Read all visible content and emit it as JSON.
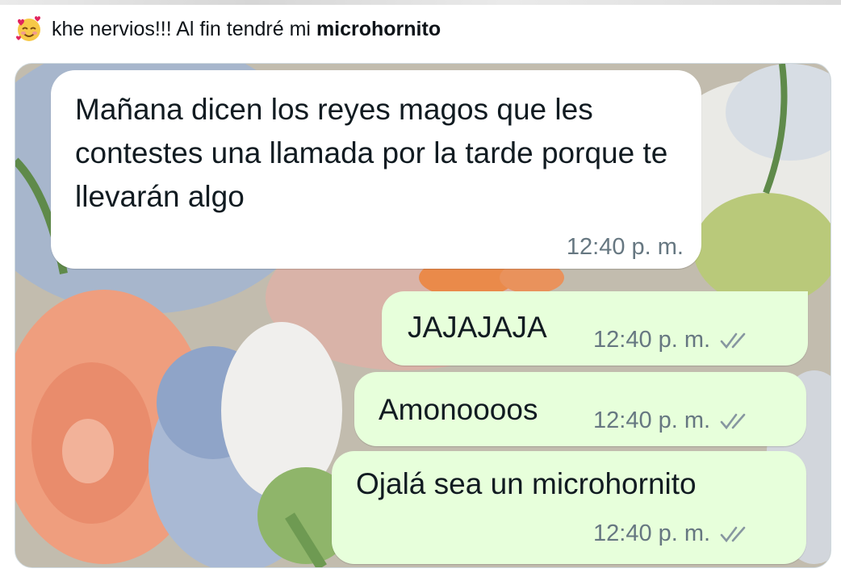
{
  "tweet": {
    "text": "khe nervios!!! Al fin tendré mi ",
    "bold": "microhornito",
    "emoji": "smiling-face-with-hearts-icon"
  },
  "chat": {
    "messages": [
      {
        "direction": "incoming",
        "text": "Mañana dicen los reyes magos que les contestes una llamada por la tarde porque te llevarán algo",
        "time": "12:40 p. m."
      },
      {
        "direction": "outgoing",
        "text": "JAJAJAJA",
        "time": "12:40 p. m.",
        "status": "read-ticks-icon"
      },
      {
        "direction": "outgoing",
        "text": "Amonoooos",
        "time": "12:40 p. m.",
        "status": "read-ticks-icon"
      },
      {
        "direction": "outgoing",
        "text": "Ojalá sea un microhornito",
        "time": "12:40 p. m.",
        "status": "read-ticks-icon"
      }
    ]
  },
  "colors": {
    "incoming_bubble": "#ffffff",
    "outgoing_bubble": "#e7ffdb",
    "timestamp": "#667781",
    "ticks": "#8696a0"
  }
}
